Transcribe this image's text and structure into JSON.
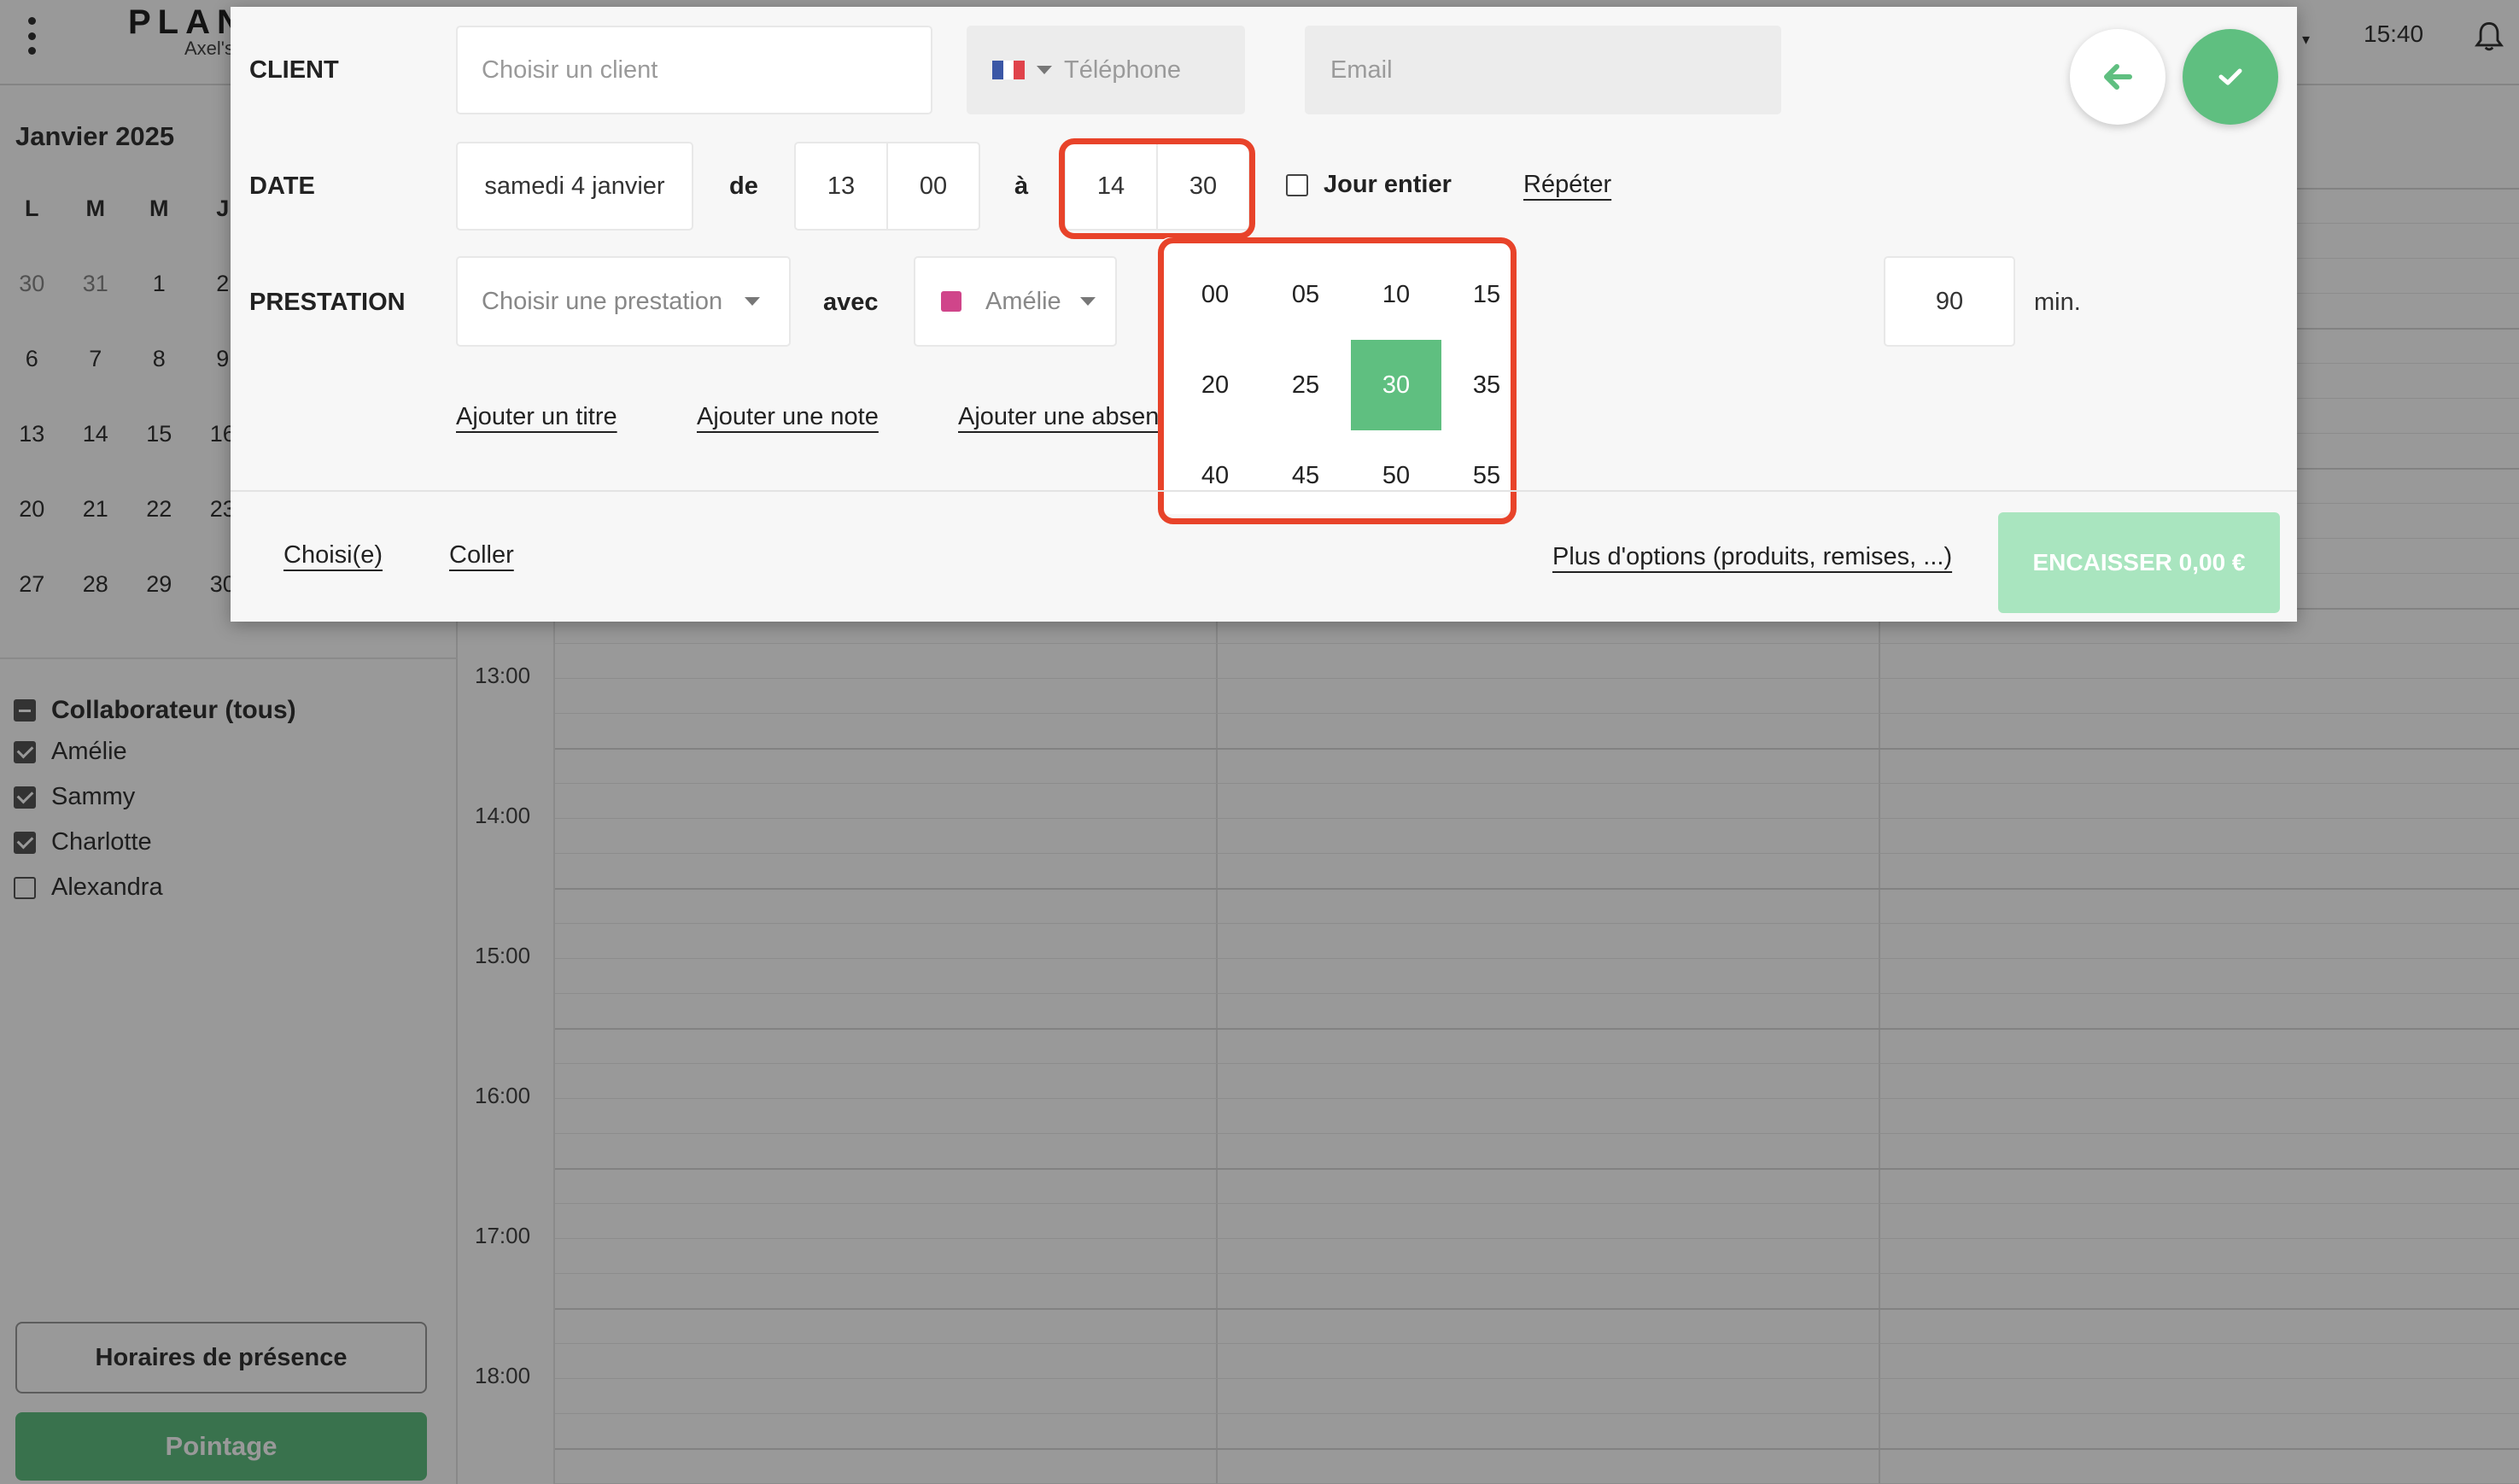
{
  "topbar": {
    "logo": "PLAN",
    "logo_sub": "Axel's",
    "time": "15:40",
    "caret": "▾"
  },
  "sidebar": {
    "month": "Janvier 2025",
    "weekdays": [
      "L",
      "M",
      "M",
      "J",
      "",
      "",
      ""
    ],
    "weeks": [
      [
        "30",
        "31",
        "1",
        "2"
      ],
      [
        "6",
        "7",
        "8",
        "9"
      ],
      [
        "13",
        "14",
        "15",
        "16"
      ],
      [
        "20",
        "21",
        "22",
        "23"
      ],
      [
        "27",
        "28",
        "29",
        "30"
      ]
    ],
    "collaborators_title": "Collaborateur (tous)",
    "collaborators": [
      {
        "name": "Amélie",
        "checked": true
      },
      {
        "name": "Sammy",
        "checked": true
      },
      {
        "name": "Charlotte",
        "checked": true
      },
      {
        "name": "Alexandra",
        "checked": false
      }
    ],
    "presence_button": "Horaires de présence",
    "pointage_button": "Pointage"
  },
  "agenda": {
    "times": [
      "13:00",
      "14:00",
      "15:00",
      "16:00",
      "17:00",
      "18:00"
    ]
  },
  "modal": {
    "client_label": "CLIENT",
    "client_placeholder": "Choisir un client",
    "phone_placeholder": "Téléphone",
    "email_placeholder": "Email",
    "date_label": "DATE",
    "date_value": "samedi 4 janvier",
    "from_label": "de",
    "from_hour": "13",
    "from_minute": "00",
    "to_label": "à",
    "to_hour": "14",
    "to_minute": "30",
    "all_day_label": "Jour entier",
    "repeat_link": "Répéter",
    "prestation_label": "PRESTATION",
    "prestation_placeholder": "Choisir une prestation",
    "with_label": "avec",
    "staff_value": "Amélie",
    "staff_color": "#d0458a",
    "duration_value": "90",
    "duration_unit": "min.",
    "add_title_link": "Ajouter un titre",
    "add_note_link": "Ajouter une note",
    "add_absence_link": "Ajouter une absen",
    "chosen_link": "Choisi(e)",
    "paste_link": "Coller",
    "more_options_link": "Plus d'options (produits, remises, ...)",
    "encaisser_button": "ENCAISSER 0,00 €",
    "back_icon": "arrow-left-icon",
    "confirm_icon": "check-icon"
  },
  "minute_picker": {
    "options": [
      "00",
      "05",
      "10",
      "15",
      "20",
      "25",
      "30",
      "35",
      "40",
      "45",
      "50",
      "55"
    ],
    "selected": "30"
  },
  "colors": {
    "accent_green": "#5fbf80",
    "highlight_red": "#e8432a"
  }
}
